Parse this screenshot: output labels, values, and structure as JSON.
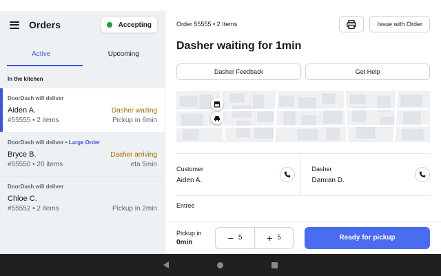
{
  "left": {
    "title": "Orders",
    "status_label": "Accepting",
    "tabs": [
      {
        "label": "Active"
      },
      {
        "label": "Upcoming"
      }
    ],
    "section_label": "In the kitchen",
    "orders": [
      {
        "delivery": "DoorDash will deliver",
        "tag": "",
        "name": "Aiden A.",
        "status": "Dasher waiting",
        "meta": "#55555 • 2 items",
        "eta": "Pickup in 6min"
      },
      {
        "delivery": "DoorDash will deliver •",
        "tag": "Large Order",
        "name": "Bryce B.",
        "status": "Dasher arriving",
        "meta": "#55550 • 20 items",
        "eta": "eta 5min"
      },
      {
        "delivery": "DoorDash will deliver",
        "tag": "",
        "name": "Chloe C.",
        "status": "",
        "meta": "#55552 • 2 items",
        "eta": "Pickup in 2min"
      }
    ]
  },
  "detail": {
    "order_id": "Order 55555 • 2 Items",
    "issue_label": "Issue with Order",
    "headline": "Dasher waiting for 1min",
    "feedback_label": "Dasher Feedback",
    "help_label": "Get Help",
    "customer_label": "Customer",
    "customer_name": "Aiden A.",
    "dasher_label": "Dasher",
    "dasher_name": "Damian D.",
    "section": "Entree"
  },
  "footer": {
    "pickup_label": "Pickup in",
    "pickup_time": "0min",
    "minus_value": "5",
    "plus_value": "5",
    "ready_label": "Ready for pickup"
  },
  "colors": {
    "accent": "#3d55d6",
    "primary_button": "#4a6cf0",
    "status_warning": "#a36a00",
    "accepting_dot": "#1f9d3a"
  },
  "icons": [
    "menu-icon",
    "printer-icon",
    "store-icon",
    "car-icon",
    "phone-icon",
    "minus-icon",
    "plus-icon",
    "back-icon",
    "home-icon",
    "recents-icon"
  ]
}
